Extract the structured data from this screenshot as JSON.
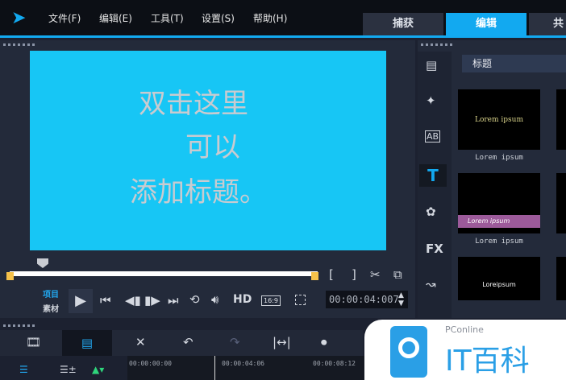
{
  "menu": {
    "items": [
      "文件(F)",
      "编辑(E)",
      "工具(T)",
      "设置(S)",
      "帮助(H)"
    ]
  },
  "tabs": [
    {
      "label": "捕获"
    },
    {
      "label": "编辑"
    },
    {
      "label": "共"
    }
  ],
  "preview": {
    "title_lines": [
      "双击这里",
      "可以",
      "添加标题。"
    ],
    "mode_project": "项目",
    "mode_clip": "素材",
    "hd_label": "HD",
    "aspect_label": "16:9",
    "timecode": "00:00:04:007"
  },
  "library": {
    "category": "标题",
    "thumbs": [
      {
        "caption": "Lorem ipsum",
        "text": "Lorem ipsum"
      },
      {
        "caption": "Lorem ipsum",
        "text": "Lorem ipsum"
      },
      {
        "caption": "",
        "text": "Loreipsum"
      }
    ]
  },
  "timeline": {
    "ticks": [
      "00:00:00:00",
      "00:00:04:06",
      "00:00:08:12"
    ]
  },
  "watermark": {
    "brand": "PConline",
    "name": "IT百科"
  },
  "colors": {
    "accent": "#12a9f0",
    "screen": "#17c6f5"
  }
}
